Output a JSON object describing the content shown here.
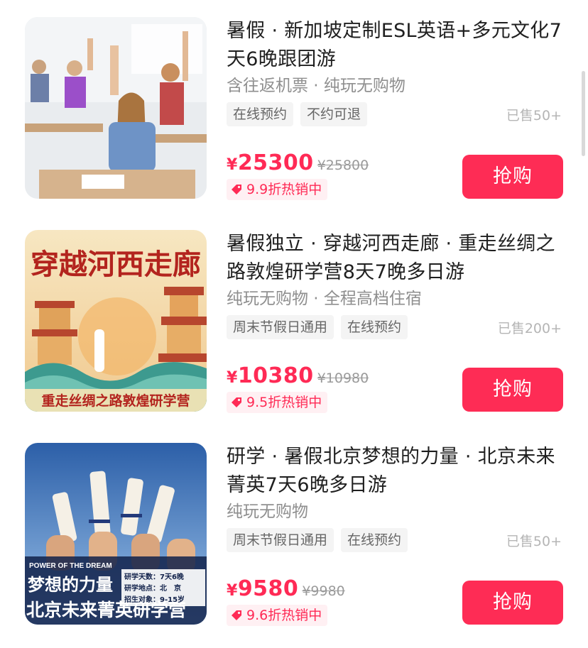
{
  "products": [
    {
      "title": "暑假 · 新加坡定制ESL英语+多元文化7天6晚跟团游",
      "subtitle": "含往返机票 · 纯玩无购物",
      "tags": [
        "在线预约",
        "不约可退"
      ],
      "sold": "已售50+",
      "price_symbol": "¥",
      "price": "25300",
      "original_price": "¥25800",
      "promo": "9.9折热销中",
      "buy_label": "抢购",
      "image": {
        "description_icon": "classroom-photo"
      }
    },
    {
      "title": "暑假独立 · 穿越河西走廊 · 重走丝绸之路敦煌研学营8天7晚多日游",
      "subtitle": "纯玩无购物 · 全程高档住宿",
      "tags": [
        "周末节假日通用",
        "在线预约"
      ],
      "sold": "已售200+",
      "price_symbol": "¥",
      "price": "10380",
      "original_price": "¥10980",
      "promo": "9.5折热销中",
      "buy_label": "抢购",
      "image": {
        "banner_top": "穿越河西走廊",
        "banner_bottom": "重走丝绸之路敦煌研学营"
      }
    },
    {
      "title": "研学 · 暑假北京梦想的力量 · 北京未来菁英7天6晚多日游",
      "subtitle": "纯玩无购物",
      "tags": [
        "周末节假日通用",
        "在线预约"
      ],
      "sold": "已售50+",
      "price_symbol": "¥",
      "price": "9580",
      "original_price": "¥9980",
      "promo": "9.6折热销中",
      "buy_label": "抢购",
      "image": {
        "eng_line": "POWER OF THE DREAM",
        "caption_1": "梦想的力量",
        "caption_2": "北京未来菁英研学营",
        "info_1": "研学天数：7天6晚",
        "info_2": "研学地点：北　京",
        "info_3": "招生对象：9-15岁"
      }
    }
  ],
  "colors": {
    "accent": "#fe2c55",
    "tag_bg": "#f4f4f4",
    "muted": "#8f8f8f"
  }
}
